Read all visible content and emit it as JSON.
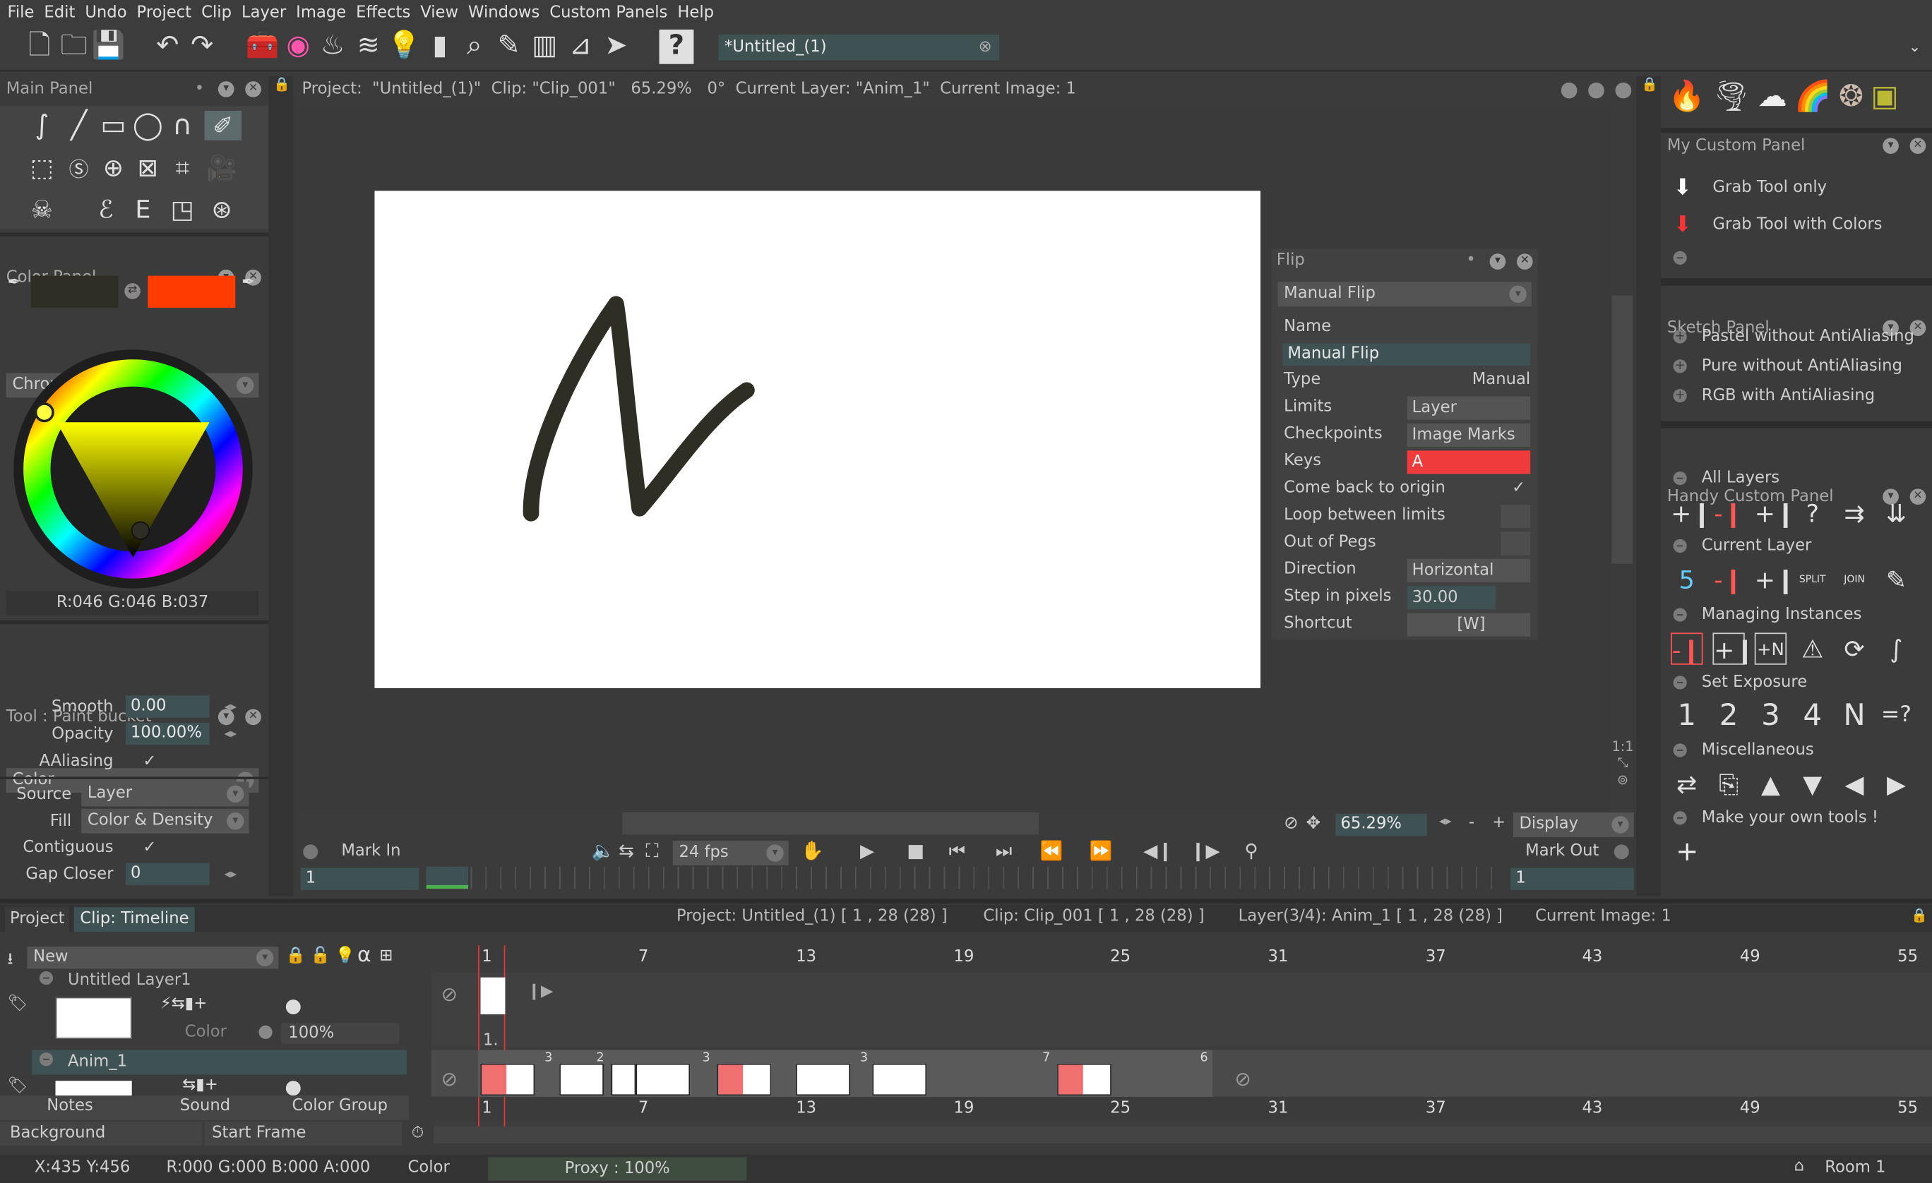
{
  "menu": [
    "File",
    "Edit",
    "Undo",
    "Project",
    "Clip",
    "Layer",
    "Image",
    "Effects",
    "View",
    "Windows",
    "Custom Panels",
    "Help"
  ],
  "toolbar": {
    "tab_title": "*Untitled_(1)"
  },
  "main_panel": {
    "title": "Main Panel"
  },
  "color_panel": {
    "title": "Color Panel",
    "mode": "Chromatic Wheel",
    "rgb": "R:046 G:046 B:037",
    "primary": "#2e2e25",
    "secondary": "#ff3c00"
  },
  "tool_panel": {
    "title": "Tool : Paint bucket",
    "section": "Color",
    "smooth_label": "Smooth",
    "smooth": "0.00",
    "opacity_label": "Opacity",
    "opacity": "100.00%",
    "aaliasing_label": "AAliasing",
    "source_label": "Source",
    "source": "Layer",
    "fill_label": "Fill",
    "fill": "Color & Density",
    "contiguous_label": "Contiguous",
    "gap_label": "Gap Closer",
    "gap": "0"
  },
  "info_bar": "Project:  \"Untitled_(1)\"  Clip: \"Clip_001\"   65.29%   0°  Current Layer: \"Anim_1\"  Current Image: 1",
  "flip": {
    "title": "Flip",
    "preset": "Manual Flip",
    "name_label": "Name",
    "name": "Manual Flip",
    "type_label": "Type",
    "type": "Manual",
    "limits_label": "Limits",
    "limits": "Layer",
    "checkpoints_label": "Checkpoints",
    "checkpoints": "Image Marks",
    "keys_label": "Keys",
    "keys": "A",
    "cbo_label": "Come back to origin",
    "loop_label": "Loop between limits",
    "pegs_label": "Out of Pegs",
    "direction_label": "Direction",
    "direction": "Horizontal",
    "step_label": "Step in pixels",
    "step": "30.00",
    "shortcut_label": "Shortcut",
    "shortcut": "[W]"
  },
  "view_bar": {
    "zoom": "65.29%",
    "minus": "-",
    "plus": "+",
    "display": "Display"
  },
  "playbar": {
    "mark_in": "Mark In",
    "fps": "24 fps",
    "mark_out": "Mark Out",
    "in_value": "1",
    "out_value": "1"
  },
  "custom_panel": {
    "title": "My Custom Panel",
    "items": [
      "Grab Tool only",
      "Grab Tool with Colors"
    ]
  },
  "sketch_panel": {
    "title": "Sketch Panel",
    "items": [
      "Pastel without AntiAliasing",
      "Pure without AntiAliasing",
      "RGB with AntiAliasing"
    ]
  },
  "handy_panel": {
    "title": "Handy Custom Panel",
    "sections": [
      "All Layers",
      "Current Layer",
      "Managing Instances",
      "Set Exposure",
      "Miscellaneous",
      "Make your own tools !"
    ],
    "exposure": [
      "1",
      "2",
      "3",
      "4",
      "N",
      "=?"
    ],
    "split": "SPLIT",
    "join": "JOIN"
  },
  "timeline": {
    "tab_project": "Project",
    "tab_clip": "Clip: Timeline",
    "info_project": "Project: Untitled_(1) [ 1 , 28  (28) ]",
    "info_clip": "Clip: Clip_001 [ 1 , 28  (28) ]",
    "info_layer": "Layer(3/4): Anim_1 [ 1 , 28  (28) ]",
    "info_image": "Current Image: 1",
    "new_label": "New",
    "layer1": "Untitled Layer1",
    "layer1_color": "Color",
    "layer1_opacity": "100%",
    "layer2": "Anim_1",
    "ticks": [
      "1",
      "7",
      "13",
      "19",
      "25",
      "31",
      "37",
      "43",
      "49",
      "55"
    ],
    "frame_label": "1.",
    "notes": "Notes",
    "sound": "Sound",
    "color_group": "Color Group",
    "background": "Background",
    "start_frame": "Start Frame",
    "cell_numbers": [
      "3",
      "2",
      "3",
      "3",
      "7",
      "6"
    ]
  },
  "status": {
    "coords": "X:435  Y:456",
    "rgba": "R:000 G:000 B:000 A:000",
    "mode": "Color",
    "proxy": "Proxy : 100%",
    "room": "Room 1"
  }
}
